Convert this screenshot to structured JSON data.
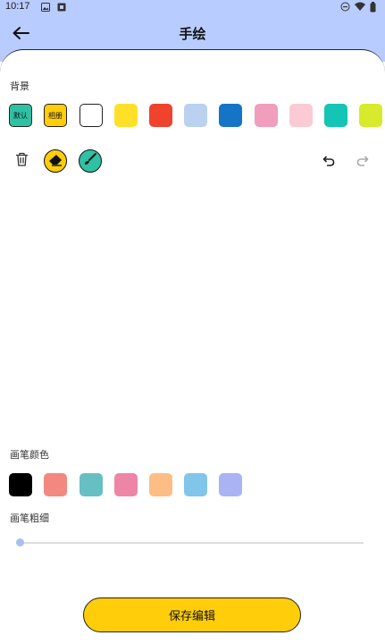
{
  "status_bar": {
    "time": "10:17",
    "left_icons": [
      "image-icon",
      "notification-icon"
    ],
    "right_icons": [
      "dnd-icon",
      "wifi-icon",
      "battery-icon"
    ]
  },
  "app_bar": {
    "title": "手绘",
    "back_icon": "arrow-left-icon",
    "background": "#b8ccff"
  },
  "background_section": {
    "label": "背景",
    "options": [
      {
        "label": "默认",
        "color": "#2fc1a4"
      },
      {
        "label": "相册",
        "color": "#ffcd0a"
      },
      {
        "label": "",
        "color": "#ffffff"
      },
      {
        "label": "",
        "color": "#ffe029"
      },
      {
        "label": "",
        "color": "#f0432d"
      },
      {
        "label": "",
        "color": "#bad1f0"
      },
      {
        "label": "",
        "color": "#1674c7"
      },
      {
        "label": "",
        "color": "#f19ebc"
      },
      {
        "label": "",
        "color": "#fbcad4"
      },
      {
        "label": "",
        "color": "#14c4b5"
      },
      {
        "label": "",
        "color": "#d7ea2c"
      }
    ]
  },
  "tools": {
    "delete_icon": "trash-icon",
    "eraser_icon": "eraser-icon",
    "brush_icon": "brush-icon",
    "undo_icon": "undo-icon",
    "redo_icon": "redo-icon",
    "eraser_color": "#ffcd0a",
    "brush_color": "#2fc1a4"
  },
  "pen_color_section": {
    "label": "画笔颜色",
    "colors": [
      "#000000",
      "#f28880",
      "#66bfc3",
      "#ed86a6",
      "#fdbd85",
      "#81c5ea",
      "#aab4f4"
    ]
  },
  "pen_width_section": {
    "label": "画笔粗细",
    "value": 0
  },
  "save_button": {
    "label": "保存编辑",
    "color": "#ffcd0a"
  }
}
